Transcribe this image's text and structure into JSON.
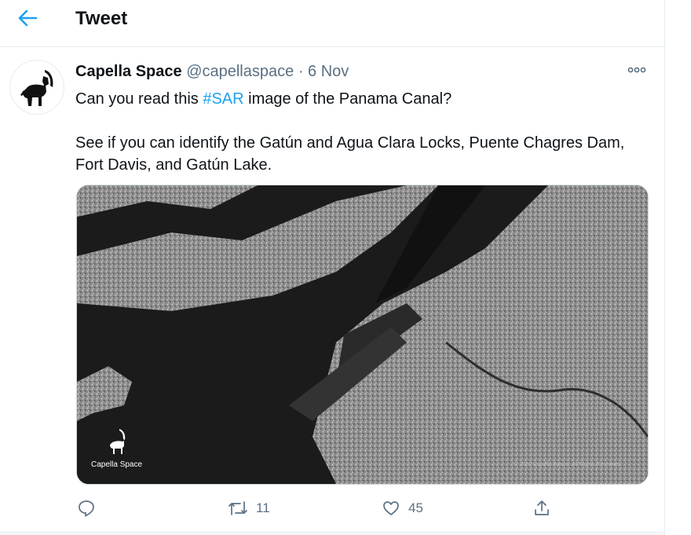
{
  "header": {
    "title": "Tweet"
  },
  "tweet": {
    "author_name": "Capella Space",
    "handle": "@capellaspace",
    "separator": "·",
    "date": "6 Nov",
    "line1_before": "Can you read this ",
    "hashtag": "#SAR",
    "line1_after": " image of the Panama Canal?",
    "line2": "See if you can identify the Gatún and Agua Clara Locks, Puente Chagres Dam, Fort Davis, and Gatún Lake."
  },
  "media": {
    "logo_text": "Capella Space",
    "copyright": "© 2020 Capella Space. All Rights Reserved."
  },
  "actions": {
    "retweets": "11",
    "likes": "45"
  },
  "colors": {
    "accent": "#1da1f2",
    "muted": "#5b7083"
  },
  "icons": [
    "back-arrow-icon",
    "more-icon",
    "reply-icon",
    "retweet-icon",
    "like-icon",
    "share-icon",
    "ibex-logo-icon"
  ]
}
